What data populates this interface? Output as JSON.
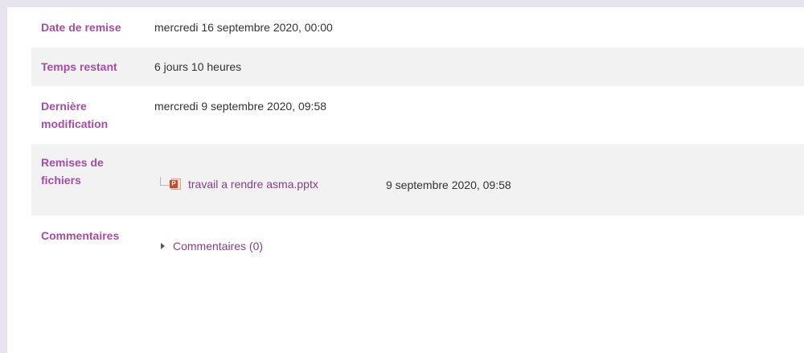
{
  "submission": {
    "due_date": {
      "label": "Date de remise",
      "value": "mercredi 16 septembre 2020, 00:00"
    },
    "time_remaining": {
      "label": "Temps restant",
      "value": "6 jours 10 heures"
    },
    "last_modified": {
      "label_line1": "Dernière",
      "label_line2": "modification",
      "value": "mercredi 9 septembre 2020, 09:58"
    },
    "file_submissions": {
      "label_line1": "Remises de",
      "label_line2": "fichiers",
      "file_icon": "pptx-file-icon",
      "file_icon_badge": "P",
      "file_name": "travail a rendre asma.pptx",
      "file_date": "9 septembre 2020, 09:58"
    },
    "comments": {
      "label": "Commentaires",
      "toggle_icon": "caret-right-icon",
      "toggle_label": "Commentaires (0)"
    }
  },
  "colors": {
    "label": "#a64ca6",
    "link": "#8a3d8a",
    "shaded_row": "#f2f2f2",
    "page_background": "#e8e4ef"
  }
}
